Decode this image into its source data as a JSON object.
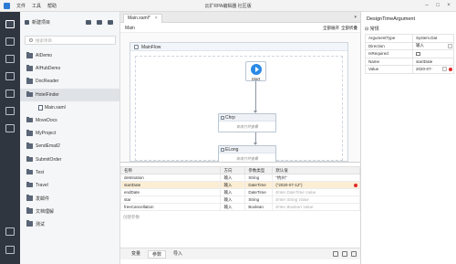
{
  "window": {
    "title": "云扩RPA编辑器 社区版",
    "menus": [
      "文件",
      "工具",
      "帮助"
    ]
  },
  "projects": {
    "new_label": "新建项目",
    "search_placeholder": "搜索项目",
    "items": [
      {
        "label": "AIDemo",
        "type": "folder"
      },
      {
        "label": "AIHubDemo",
        "type": "folder"
      },
      {
        "label": "DocReader",
        "type": "folder"
      },
      {
        "label": "HotelFinder",
        "type": "folder",
        "selected": true
      },
      {
        "label": "Main.xaml",
        "type": "file"
      },
      {
        "label": "MoveDocs",
        "type": "folder"
      },
      {
        "label": "MyProject",
        "type": "folder"
      },
      {
        "label": "SendEmail2",
        "type": "folder"
      },
      {
        "label": "SubmitOrder",
        "type": "folder"
      },
      {
        "label": "Test",
        "type": "folder"
      },
      {
        "label": "Travel",
        "type": "folder"
      },
      {
        "label": "发邮件",
        "type": "folder"
      },
      {
        "label": "文档理解",
        "type": "folder"
      },
      {
        "label": "测试",
        "type": "folder"
      }
    ]
  },
  "editor": {
    "tab_label": "Main.xaml*",
    "tab_close": "×",
    "tab_dropdown": "▾",
    "breadcrumb": "Main",
    "expand_all": "全部展开",
    "collapse_all": "全部折叠",
    "flow": {
      "title": "MainFlow",
      "start_label": "Start",
      "activities": [
        {
          "title": "Chrp",
          "hint": "双击打开查看"
        },
        {
          "title": "ELong",
          "hint": "双击打开查看"
        }
      ]
    }
  },
  "arguments": {
    "headers": [
      "名称",
      "方向",
      "参数类型",
      "默认值"
    ],
    "rows": [
      {
        "name": "destination",
        "direction": "输入",
        "type": "String",
        "default": "\"杭州\"",
        "placeholder": false
      },
      {
        "name": "startDate",
        "direction": "输入",
        "type": "DateTime",
        "default": "(\"2020-07-12\")",
        "placeholder": false,
        "selected": true,
        "error": true
      },
      {
        "name": "endDate",
        "direction": "输入",
        "type": "DateTime",
        "default": "Enter DateTime Value",
        "placeholder": true
      },
      {
        "name": "star",
        "direction": "输入",
        "type": "String",
        "default": "Enter String Value",
        "placeholder": true
      },
      {
        "name": "freeCancellation",
        "direction": "输入",
        "type": "Boolean",
        "default": "Enter Boolean Value",
        "placeholder": true
      }
    ],
    "create_label": "创建参数"
  },
  "bottom_tabs": [
    "变量",
    "参数",
    "导入"
  ],
  "properties": {
    "title": "DesignTimeArgument",
    "group": "常规",
    "rows": [
      {
        "key": "ArgumentType",
        "value": "System.Dat"
      },
      {
        "key": "Direction",
        "value": "输入"
      },
      {
        "key": "IsRequired",
        "value": ""
      },
      {
        "key": "Name",
        "value": "startDate"
      },
      {
        "key": "Value",
        "value": "2020-07-"
      }
    ]
  }
}
